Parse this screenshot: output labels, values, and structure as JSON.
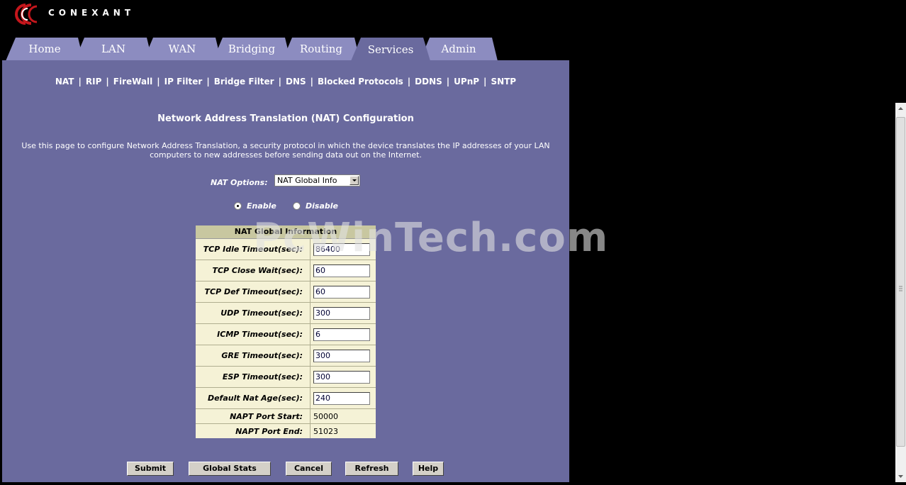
{
  "brand": {
    "logo_text": "CONEXANT",
    "accent_red": "#c4161c"
  },
  "tabs": [
    {
      "label": "Home",
      "active": false
    },
    {
      "label": "LAN",
      "active": false
    },
    {
      "label": "WAN",
      "active": false
    },
    {
      "label": "Bridging",
      "active": false
    },
    {
      "label": "Routing",
      "active": false
    },
    {
      "label": "Services",
      "active": true
    },
    {
      "label": "Admin",
      "active": false
    }
  ],
  "subnav": [
    "NAT",
    "RIP",
    "FireWall",
    "IP Filter",
    "Bridge Filter",
    "DNS",
    "Blocked Protocols",
    "DDNS",
    "UPnP",
    "SNTP"
  ],
  "page": {
    "title": "Network Address Translation (NAT) Configuration",
    "description": "Use this page to configure Network Address Translation, a security protocol in which the device translates the IP addresses of your LAN computers to new addresses before sending data out on the Internet."
  },
  "nat_options": {
    "label": "NAT Options:",
    "selected": "NAT Global Info"
  },
  "mode": {
    "enable_label": "Enable",
    "disable_label": "Disable",
    "selected": "Enable"
  },
  "table": {
    "header": "NAT Global Information",
    "rows": [
      {
        "label": "TCP Idle Timeout(sec):",
        "value": "86400"
      },
      {
        "label": "TCP Close Wait(sec):",
        "value": "60"
      },
      {
        "label": "TCP Def Timeout(sec):",
        "value": "60"
      },
      {
        "label": "UDP Timeout(sec):",
        "value": "300"
      },
      {
        "label": "ICMP Timeout(sec):",
        "value": "6"
      },
      {
        "label": "GRE Timeout(sec):",
        "value": "300"
      },
      {
        "label": "ESP Timeout(sec):",
        "value": "300"
      },
      {
        "label": "Default Nat Age(sec):",
        "value": "240"
      }
    ],
    "static_rows": [
      {
        "label": "NAPT Port Start:",
        "value": "50000"
      },
      {
        "label": "NAPT Port End:",
        "value": "51023"
      }
    ]
  },
  "buttons": {
    "submit": "Submit",
    "global_stats": "Global Stats",
    "cancel": "Cancel",
    "refresh": "Refresh",
    "help": "Help"
  },
  "watermark": "PcWinTech.com",
  "colors": {
    "panel": "#6a6a9e",
    "tab": "#8c8cc0",
    "table_bg": "#f5f2d6",
    "table_header": "#c8c7a0"
  }
}
